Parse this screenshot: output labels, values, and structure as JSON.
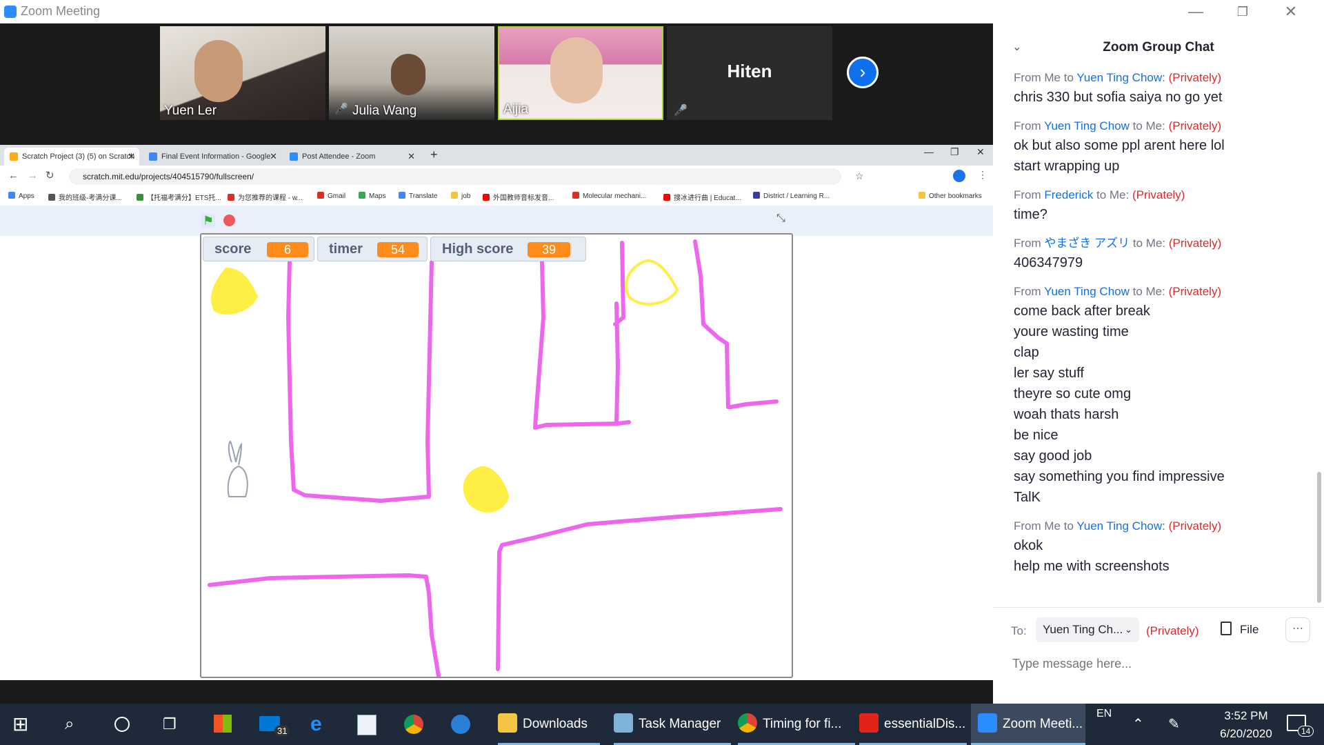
{
  "app": {
    "title": "Zoom Meeting"
  },
  "participants": [
    {
      "name": "Yuen Ler",
      "muted": false
    },
    {
      "name": "Julia Wang",
      "muted": true
    },
    {
      "name": "Aijia",
      "muted": false
    },
    {
      "name": "Hiten",
      "muted": true
    }
  ],
  "browser": {
    "tabs": [
      {
        "label": "Scratch Project (3) (5) on Scratch"
      },
      {
        "label": "Final Event Information - Google"
      },
      {
        "label": "Post Attendee - Zoom"
      }
    ],
    "url": "scratch.mit.edu/projects/404515790/fullscreen/",
    "bookmarks": [
      "Apps",
      "我的班级-考满分课...",
      "【托福考满分】ETS托...",
      "为您推荐的课程 - w...",
      "Gmail",
      "Maps",
      "Translate",
      "job",
      "外国教师音标发音...",
      "Molecular mechani...",
      "搜冰进行曲 | Educat...",
      "District / Learning R...",
      "Other bookmarks"
    ]
  },
  "game": {
    "score_label": "score",
    "score": "6",
    "timer_label": "timer",
    "timer": "54",
    "high_label": "High score",
    "high": "39"
  },
  "chat": {
    "title": "Zoom Group Chat",
    "messages": [
      {
        "from": "Me",
        "to": "Yuen Ting Chow:",
        "privately": "(Privately)",
        "lines": [
          "chris 330 but sofia saiya no go yet"
        ]
      },
      {
        "from": "Yuen Ting Chow",
        "to": "Me:",
        "privately": "(Privately)",
        "lines": [
          "ok but also some ppl arent here lol",
          "start wrapping up"
        ]
      },
      {
        "from": "Frederick",
        "to": "Me:",
        "privately": "(Privately)",
        "lines": [
          "time?"
        ]
      },
      {
        "from": "やまざき アズリ",
        "to": "Me:",
        "privately": "(Privately)",
        "lines": [
          "406347979"
        ]
      },
      {
        "from": "Yuen Ting Chow",
        "to": "Me:",
        "privately": "(Privately)",
        "lines": [
          "come back after break",
          "youre wasting time",
          "clap",
          "ler say stuff",
          "theyre so cute omg",
          "woah thats harsh",
          "be nice",
          "say good job",
          "say something you find impressive",
          "TalK"
        ]
      },
      {
        "from": "Me",
        "to": "Yuen Ting Chow:",
        "privately": "(Privately)",
        "lines": [
          "okok",
          "help me with screenshots"
        ]
      }
    ],
    "compose": {
      "to_label": "To:",
      "to_value": "Yuen Ting Ch...",
      "privately": "(Privately)",
      "file_label": "File",
      "placeholder": "Type message here..."
    }
  },
  "taskbar": {
    "apps": [
      "Downloads",
      "Task Manager",
      "Timing for fi...",
      "essentialDis...",
      "Zoom Meeti..."
    ],
    "mail_badge": "31",
    "lang": "EN",
    "time": "3:52 PM",
    "date": "6/20/2020",
    "notif_count": "14"
  },
  "colors": {
    "zoom_blue": "#0e71eb",
    "private_red": "#e02828",
    "scratch_orange": "#ff8c1a",
    "pen_pink": "#ee66ee",
    "pen_yellow": "#ffee44"
  }
}
